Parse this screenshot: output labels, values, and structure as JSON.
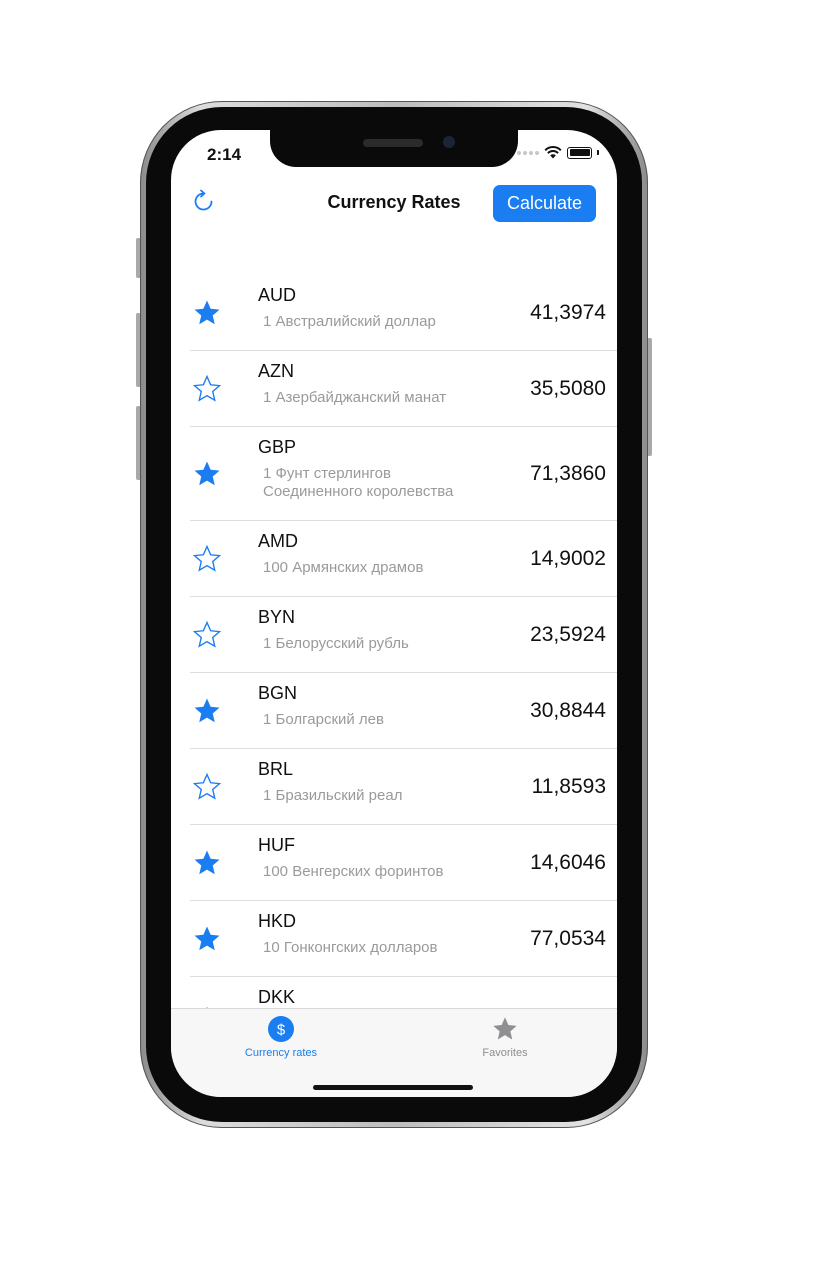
{
  "status_bar": {
    "time": "2:14"
  },
  "nav": {
    "title": "Currency Rates",
    "calculate_label": "Calculate"
  },
  "currencies": [
    {
      "code": "AUD",
      "name": "1 Австралийский доллар",
      "rate": "41,3974",
      "favorite": true
    },
    {
      "code": "AZN",
      "name": "1 Азербайджанский манат",
      "rate": "35,5080",
      "favorite": false
    },
    {
      "code": "GBP",
      "name": "1 Фунт стерлингов Соединенного королевства",
      "rate": "71,3860",
      "favorite": true
    },
    {
      "code": "AMD",
      "name": "100 Армянских драмов",
      "rate": "14,9002",
      "favorite": false
    },
    {
      "code": "BYN",
      "name": "1 Белорусский рубль",
      "rate": "23,5924",
      "favorite": false
    },
    {
      "code": "BGN",
      "name": "1 Болгарский лев",
      "rate": "30,8844",
      "favorite": true
    },
    {
      "code": "BRL",
      "name": "1 Бразильский реал",
      "rate": "11,8593",
      "favorite": false
    },
    {
      "code": "HUF",
      "name": "100 Венгерских форинтов",
      "rate": "14,6046",
      "favorite": true
    },
    {
      "code": "HKD",
      "name": "10 Гонконгских долларов",
      "rate": "77,0534",
      "favorite": true
    },
    {
      "code": "DKK",
      "name": "",
      "rate": "",
      "favorite": false
    }
  ],
  "tabs": [
    {
      "label": "Currency rates",
      "icon": "dollar-circle-icon",
      "active": true
    },
    {
      "label": "Favorites",
      "icon": "star-icon",
      "active": false
    }
  ],
  "colors": {
    "accent": "#1a7df2",
    "star_filled": "#1a7df2",
    "inactive_tab": "#8e8e93"
  }
}
